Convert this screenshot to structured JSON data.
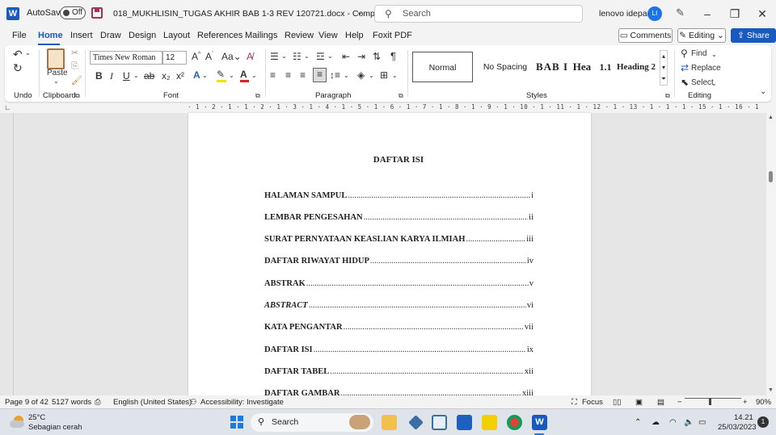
{
  "titlebar": {
    "app_icon": "W",
    "autosave_label": "AutoSave",
    "autosave_state": "Off",
    "document_title": "018_MUKHLISIN_TUGAS AKHIR BAB 1-3 REV 120721.docx  -  Compatibility Mode",
    "search_placeholder": "Search",
    "user_name": "lenovo idepad",
    "user_initials": "LI"
  },
  "menu": {
    "tabs": [
      "File",
      "Home",
      "Insert",
      "Draw",
      "Design",
      "Layout",
      "References",
      "Mailings",
      "Review",
      "View",
      "Help",
      "Foxit PDF"
    ],
    "active_tab": "Home",
    "comments_label": "Comments",
    "editing_label": "Editing",
    "share_label": "Share"
  },
  "ribbon": {
    "groups": {
      "undo": "Undo",
      "clipboard": "Clipboard",
      "font": "Font",
      "paragraph": "Paragraph",
      "styles": "Styles",
      "editing": "Editing"
    },
    "paste_label": "Paste",
    "font_name": "Times New Roman",
    "font_size": "12",
    "styles": [
      "Normal",
      "No Spacing",
      "BAB I",
      "Hea",
      "1.1",
      "Heading 2"
    ],
    "find_label": "Find",
    "replace_label": "Replace",
    "select_label": "Select",
    "accent_color": "#185abd"
  },
  "ruler": {
    "text": "· 1 · 2 · 1 · 1 · 2 · 1 · 3 · 1 · 4 · 1 · 5 · 1 · 6 · 1 · 7 · 1 · 8 · 1 · 9 · 1 · 10 · 1 · 11 · 1 · 12 · 1 · 13 · 1 · 1 · 1 · 15 · 1 · 16 · 1"
  },
  "document": {
    "heading": "DAFTAR ISI",
    "toc": [
      {
        "title": "HALAMAN SAMPUL",
        "page": "i",
        "italic": false
      },
      {
        "title": "LEMBAR PENGESAHAN",
        "page": "ii",
        "italic": false
      },
      {
        "title": "SURAT PERNYATAAN KEASLIAN KARYA ILMIAH",
        "page": "iii",
        "italic": false
      },
      {
        "title": "DAFTAR RIWAYAT HIDUP",
        "page": "iv",
        "italic": false
      },
      {
        "title": "ABSTRAK",
        "page": "v",
        "italic": false
      },
      {
        "title": "ABSTRACT",
        "page": "vi",
        "italic": true
      },
      {
        "title": "KATA PENGANTAR",
        "page": "vii",
        "italic": false
      },
      {
        "title": "DAFTAR ISI",
        "page": "ix",
        "italic": false
      },
      {
        "title": "DAFTAR TABEL",
        "page": "xii",
        "italic": false
      },
      {
        "title": "DAFTAR GAMBAR",
        "page": "xiii",
        "italic": false
      }
    ]
  },
  "statusbar": {
    "page": "Page 9 of 42",
    "words": "5127 words",
    "language": "English (United States)",
    "accessibility": "Accessibility: Investigate",
    "focus": "Focus",
    "zoom": "90%"
  },
  "taskbar": {
    "temperature": "25°C",
    "condition": "Sebagian cerah",
    "search_label": "Search",
    "time": "14.21",
    "date": "25/03/2023",
    "notification_count": "1"
  }
}
